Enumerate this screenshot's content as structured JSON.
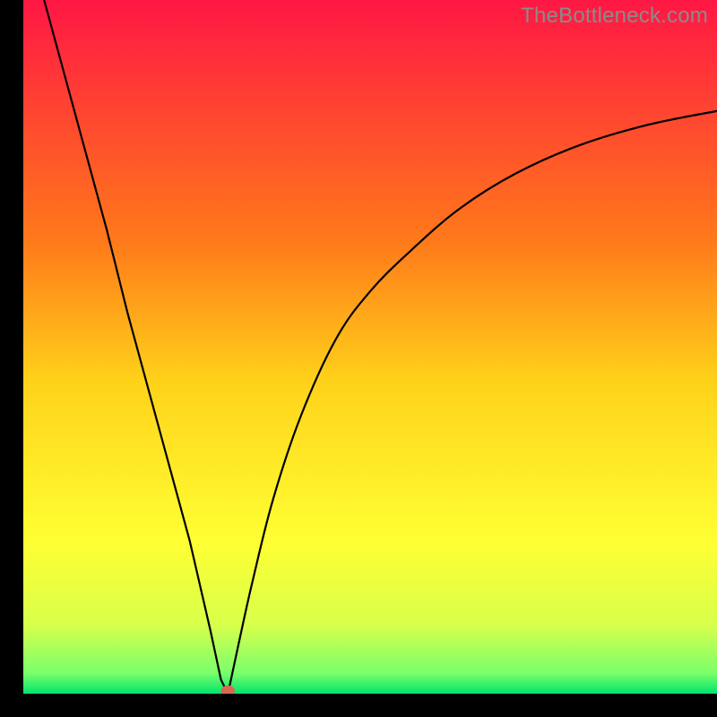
{
  "watermark": "TheBottleneck.com",
  "chart_data": {
    "type": "line",
    "title": "",
    "xlabel": "",
    "ylabel": "",
    "xlim": [
      0,
      100
    ],
    "ylim": [
      0,
      100
    ],
    "grid": false,
    "legend": false,
    "background_gradient": {
      "stops": [
        {
          "offset": 0.0,
          "color": "#ff1744"
        },
        {
          "offset": 0.35,
          "color": "#ff7a1a"
        },
        {
          "offset": 0.55,
          "color": "#ffd21a"
        },
        {
          "offset": 0.78,
          "color": "#ffff33"
        },
        {
          "offset": 0.9,
          "color": "#d8ff4a"
        },
        {
          "offset": 0.97,
          "color": "#7bff6b"
        },
        {
          "offset": 1.0,
          "color": "#00e46c"
        }
      ]
    },
    "marker": {
      "x": 29.5,
      "y": 0,
      "color": "#d46a50",
      "rx": 1.0,
      "ry": 0.8
    },
    "series": [
      {
        "name": "left-branch",
        "x": [
          3,
          6,
          9,
          12,
          15,
          18,
          21,
          24,
          27,
          28.5,
          29.5
        ],
        "y": [
          100,
          89,
          78,
          67,
          55,
          44,
          33,
          22,
          9,
          2,
          0
        ]
      },
      {
        "name": "right-branch",
        "x": [
          29.5,
          31,
          33,
          36,
          40,
          45,
          50,
          56,
          63,
          71,
          80,
          90,
          100
        ],
        "y": [
          0,
          7,
          16,
          28,
          40,
          51,
          58,
          64,
          70,
          75,
          79,
          82,
          84
        ]
      }
    ]
  }
}
